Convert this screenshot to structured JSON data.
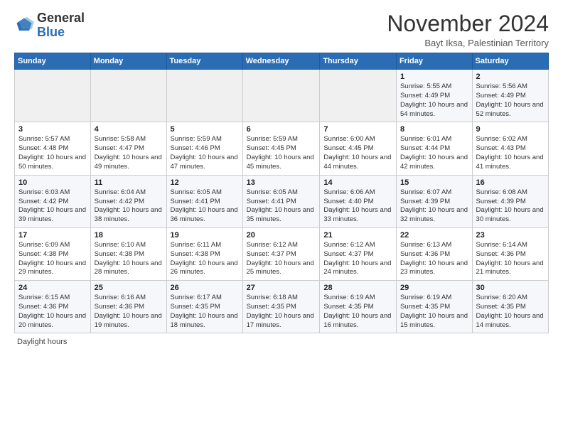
{
  "header": {
    "logo_general": "General",
    "logo_blue": "Blue",
    "month_title": "November 2024",
    "location": "Bayt Iksa, Palestinian Territory"
  },
  "days_of_week": [
    "Sunday",
    "Monday",
    "Tuesday",
    "Wednesday",
    "Thursday",
    "Friday",
    "Saturday"
  ],
  "footer": {
    "daylight_label": "Daylight hours"
  },
  "weeks": [
    [
      {
        "day": "",
        "info": ""
      },
      {
        "day": "",
        "info": ""
      },
      {
        "day": "",
        "info": ""
      },
      {
        "day": "",
        "info": ""
      },
      {
        "day": "",
        "info": ""
      },
      {
        "day": "1",
        "info": "Sunrise: 5:55 AM\nSunset: 4:49 PM\nDaylight: 10 hours and 54 minutes."
      },
      {
        "day": "2",
        "info": "Sunrise: 5:56 AM\nSunset: 4:49 PM\nDaylight: 10 hours and 52 minutes."
      }
    ],
    [
      {
        "day": "3",
        "info": "Sunrise: 5:57 AM\nSunset: 4:48 PM\nDaylight: 10 hours and 50 minutes."
      },
      {
        "day": "4",
        "info": "Sunrise: 5:58 AM\nSunset: 4:47 PM\nDaylight: 10 hours and 49 minutes."
      },
      {
        "day": "5",
        "info": "Sunrise: 5:59 AM\nSunset: 4:46 PM\nDaylight: 10 hours and 47 minutes."
      },
      {
        "day": "6",
        "info": "Sunrise: 5:59 AM\nSunset: 4:45 PM\nDaylight: 10 hours and 45 minutes."
      },
      {
        "day": "7",
        "info": "Sunrise: 6:00 AM\nSunset: 4:45 PM\nDaylight: 10 hours and 44 minutes."
      },
      {
        "day": "8",
        "info": "Sunrise: 6:01 AM\nSunset: 4:44 PM\nDaylight: 10 hours and 42 minutes."
      },
      {
        "day": "9",
        "info": "Sunrise: 6:02 AM\nSunset: 4:43 PM\nDaylight: 10 hours and 41 minutes."
      }
    ],
    [
      {
        "day": "10",
        "info": "Sunrise: 6:03 AM\nSunset: 4:42 PM\nDaylight: 10 hours and 39 minutes."
      },
      {
        "day": "11",
        "info": "Sunrise: 6:04 AM\nSunset: 4:42 PM\nDaylight: 10 hours and 38 minutes."
      },
      {
        "day": "12",
        "info": "Sunrise: 6:05 AM\nSunset: 4:41 PM\nDaylight: 10 hours and 36 minutes."
      },
      {
        "day": "13",
        "info": "Sunrise: 6:05 AM\nSunset: 4:41 PM\nDaylight: 10 hours and 35 minutes."
      },
      {
        "day": "14",
        "info": "Sunrise: 6:06 AM\nSunset: 4:40 PM\nDaylight: 10 hours and 33 minutes."
      },
      {
        "day": "15",
        "info": "Sunrise: 6:07 AM\nSunset: 4:39 PM\nDaylight: 10 hours and 32 minutes."
      },
      {
        "day": "16",
        "info": "Sunrise: 6:08 AM\nSunset: 4:39 PM\nDaylight: 10 hours and 30 minutes."
      }
    ],
    [
      {
        "day": "17",
        "info": "Sunrise: 6:09 AM\nSunset: 4:38 PM\nDaylight: 10 hours and 29 minutes."
      },
      {
        "day": "18",
        "info": "Sunrise: 6:10 AM\nSunset: 4:38 PM\nDaylight: 10 hours and 28 minutes."
      },
      {
        "day": "19",
        "info": "Sunrise: 6:11 AM\nSunset: 4:38 PM\nDaylight: 10 hours and 26 minutes."
      },
      {
        "day": "20",
        "info": "Sunrise: 6:12 AM\nSunset: 4:37 PM\nDaylight: 10 hours and 25 minutes."
      },
      {
        "day": "21",
        "info": "Sunrise: 6:12 AM\nSunset: 4:37 PM\nDaylight: 10 hours and 24 minutes."
      },
      {
        "day": "22",
        "info": "Sunrise: 6:13 AM\nSunset: 4:36 PM\nDaylight: 10 hours and 23 minutes."
      },
      {
        "day": "23",
        "info": "Sunrise: 6:14 AM\nSunset: 4:36 PM\nDaylight: 10 hours and 21 minutes."
      }
    ],
    [
      {
        "day": "24",
        "info": "Sunrise: 6:15 AM\nSunset: 4:36 PM\nDaylight: 10 hours and 20 minutes."
      },
      {
        "day": "25",
        "info": "Sunrise: 6:16 AM\nSunset: 4:36 PM\nDaylight: 10 hours and 19 minutes."
      },
      {
        "day": "26",
        "info": "Sunrise: 6:17 AM\nSunset: 4:35 PM\nDaylight: 10 hours and 18 minutes."
      },
      {
        "day": "27",
        "info": "Sunrise: 6:18 AM\nSunset: 4:35 PM\nDaylight: 10 hours and 17 minutes."
      },
      {
        "day": "28",
        "info": "Sunrise: 6:19 AM\nSunset: 4:35 PM\nDaylight: 10 hours and 16 minutes."
      },
      {
        "day": "29",
        "info": "Sunrise: 6:19 AM\nSunset: 4:35 PM\nDaylight: 10 hours and 15 minutes."
      },
      {
        "day": "30",
        "info": "Sunrise: 6:20 AM\nSunset: 4:35 PM\nDaylight: 10 hours and 14 minutes."
      }
    ]
  ]
}
